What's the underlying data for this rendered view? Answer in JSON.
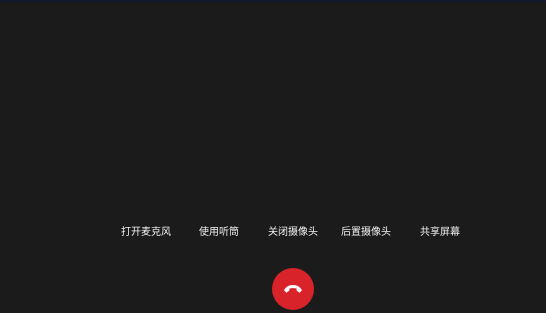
{
  "colors": {
    "background": "#1b1b1b",
    "top_strip": "#141a2e",
    "hangup": "#d9232a",
    "icon": "#ffffff"
  },
  "controls": {
    "mic": "打开麦克风",
    "earpiece": "使用听筒",
    "camera_off": "关闭摄像头",
    "rear_camera": "后置摄像头",
    "share_screen": "共享屏幕"
  },
  "hangup": {
    "icon": "phone-hangup-icon"
  }
}
